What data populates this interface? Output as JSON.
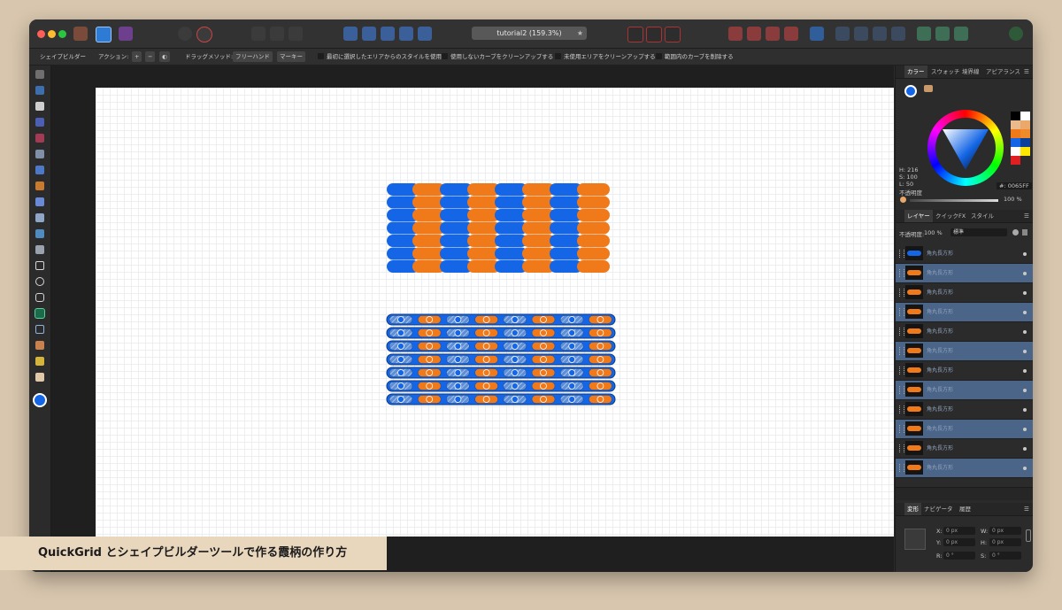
{
  "window": {
    "title": "tutorial2 (159.3%)"
  },
  "context_bar": {
    "tool_name": "シェイプビルダー",
    "action_label": "アクション:",
    "drag_method_label": "ドラッグメソッド:",
    "drag_freehand": "フリーハンド",
    "drag_marquee": "マーキー",
    "option_first_style": "最初に選択したエリアからのスタイルを使用",
    "option_clean_curves": "使用しないカーブをクリーンアップする",
    "option_clean_areas": "未使用エリアをクリーンアップする",
    "option_delete_curves": "範囲内のカーブを削除する"
  },
  "color_panel": {
    "tabs": [
      "カラー",
      "スウォッチ",
      "境界線",
      "アピアランス"
    ],
    "h_label": "H: 216",
    "s_label": "S: 100",
    "l_label": "L: 50",
    "opacity_label": "不透明度",
    "hex_value": "#: 0065FF",
    "opacity_value": "100 %"
  },
  "layers_panel": {
    "tabs": [
      "レイヤー",
      "クイックFX",
      "スタイル"
    ],
    "opacity_label": "不透明度:",
    "opacity_value": "100 %",
    "blend_mode": "標準",
    "layers": [
      {
        "name": "角丸長方形",
        "color": "#1466e6",
        "selected": false
      },
      {
        "name": "角丸長方形",
        "color": "#f07a1a",
        "selected": true
      },
      {
        "name": "角丸長方形",
        "color": "#f07a1a",
        "selected": false
      },
      {
        "name": "角丸長方形",
        "color": "#f07a1a",
        "selected": true
      },
      {
        "name": "角丸長方形",
        "color": "#f07a1a",
        "selected": false
      },
      {
        "name": "角丸長方形",
        "color": "#f07a1a",
        "selected": true
      },
      {
        "name": "角丸長方形",
        "color": "#f07a1a",
        "selected": false
      },
      {
        "name": "角丸長方形",
        "color": "#f07a1a",
        "selected": true
      },
      {
        "name": "角丸長方形",
        "color": "#f07a1a",
        "selected": false
      },
      {
        "name": "角丸長方形",
        "color": "#f07a1a",
        "selected": true
      },
      {
        "name": "角丸長方形",
        "color": "#f07a1a",
        "selected": false
      },
      {
        "name": "角丸長方形",
        "color": "#f07a1a",
        "selected": true
      }
    ]
  },
  "transform_panel": {
    "tabs": [
      "変形",
      "ナビゲータ",
      "履歴"
    ],
    "x_label": "X:",
    "x_value": "0 px",
    "y_label": "Y:",
    "y_value": "0 px",
    "w_label": "W:",
    "w_value": "0 px",
    "h_label": "H:",
    "h_value": "0 px",
    "r_label": "R:",
    "r_value": "0 °",
    "s_label": "S:",
    "s_value": "0 °"
  },
  "caption": "QuickGrid とシェイプビルダーツールで作る霞柄の作り方",
  "colors": {
    "blue": "#1466e6",
    "orange": "#f07a1a",
    "selection_row": "#4a6588"
  }
}
